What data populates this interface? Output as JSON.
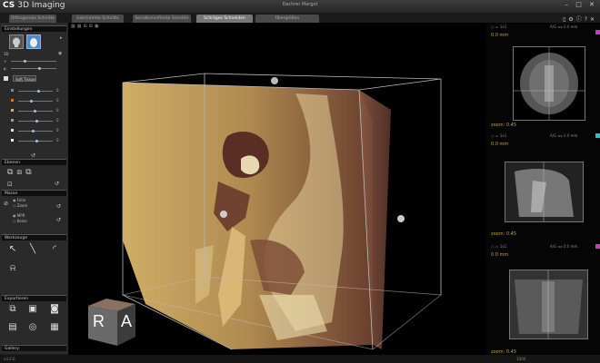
{
  "app": {
    "brand": "CS",
    "title": "3D Imaging",
    "patient": "Dachrer Margot",
    "version": "v3.2.0",
    "status_right": "1000"
  },
  "window_controls": [
    "–",
    "□",
    "✕"
  ],
  "tabs": [
    {
      "label": "Orthogonale Schnitte",
      "active": false
    },
    {
      "label": "Gekrümmte Schnitte",
      "active": false
    },
    {
      "label": "Serialbrennflecke Schnitte",
      "active": false
    },
    {
      "label": "Schräges Schneiden",
      "active": true
    },
    {
      "label": "Übergrößen",
      "active": false
    }
  ],
  "tab_icons": [
    "page-icon",
    "gear-icon",
    "info-icon",
    "help-icon",
    "close-icon"
  ],
  "sidebar": {
    "einstellungen": {
      "label": "Einstellungen",
      "mode_label": "3D",
      "preset": "Soft Tissue",
      "levels": [
        0.55,
        0.35,
        0.45,
        0.5,
        0.4,
        0.5
      ],
      "level_values": [
        "0",
        "0",
        "0",
        "0",
        "0",
        "0"
      ],
      "swatch_colors": [
        "#e07030",
        "#d4b070",
        "#b0a080",
        "#e0e0e0",
        "#f0f0f0"
      ]
    },
    "ebenen": {
      "label": "Ebenen"
    },
    "masse": {
      "label": "Masse",
      "opt1": "Folie",
      "opt2": "Zoom",
      "opt3": "MPR",
      "opt4": "Keine"
    },
    "werkzeuge": {
      "label": "Werkzeuge"
    },
    "exportieren": {
      "label": "Exportieren"
    },
    "gallery": {
      "label": "Gallery"
    }
  },
  "cube": {
    "face_right": "A",
    "face_left": "R"
  },
  "right_panels": [
    {
      "mm": "0.0 mm",
      "zoom": "zoom: 0.45",
      "mode": "A/G",
      "thickness": "0.0 mm",
      "accent": "#c040c0"
    },
    {
      "mm": "0.0 mm",
      "zoom": "zoom: 0.45",
      "mode": "A/G",
      "thickness": "0.0 mm",
      "accent": "#30c0c0"
    },
    {
      "mm": "0.0 mm",
      "zoom": "zoom: 0.45",
      "mode": "A/G",
      "thickness": "0.0 mm",
      "accent": "#c040c0"
    }
  ]
}
